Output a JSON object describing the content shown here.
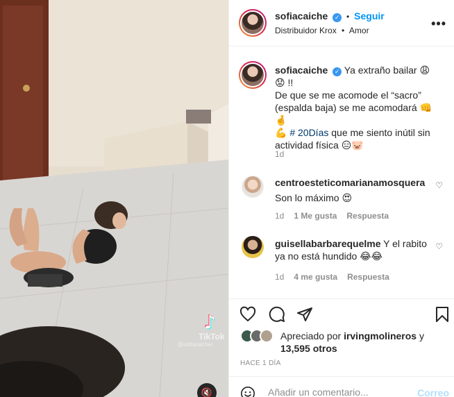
{
  "media": {
    "watermark_brand": "TikTok",
    "watermark_user": "@sofiacaicher",
    "mute_icon": "speaker-muted-icon"
  },
  "header": {
    "username": "sofiacaiche",
    "follow_label": "Seguir",
    "subtitle_left": "Distribuidor Krox",
    "separator": "•",
    "subtitle_right": "Amor",
    "more_icon": "more-dots-icon"
  },
  "caption": {
    "username": "sofiacaiche",
    "text_1": "Ya extraño bailar 😩😟 !!",
    "text_2": "De que se me acomode el “sacro” (espalda baja) se me acomodará 👊🤞",
    "text_3_emoji": "💪",
    "hashtag": "# 20Días",
    "text_4": "que me siento inútil sin actividad física 😑🐷",
    "time": "1d"
  },
  "comments": [
    {
      "username": "centroesteticomarianamosquera",
      "text": "Son lo máximo 😍",
      "time": "1d",
      "likes": "1 Me gusta",
      "reply": "Respuesta"
    },
    {
      "username": "guisellabarbarequelme",
      "text": "Y el rabito ya no está hundido 😂😂",
      "time": "1d",
      "likes": "4 me gusta",
      "reply": "Respuesta"
    }
  ],
  "likes": {
    "prefix": "Apreciado por",
    "user": "irvingmolineros",
    "connector": "y",
    "others": "13,595 otros"
  },
  "timestamp": "HACE 1 DÍA",
  "comment_box": {
    "placeholder": "Añadir un comentario...",
    "post_label": "Correo"
  }
}
